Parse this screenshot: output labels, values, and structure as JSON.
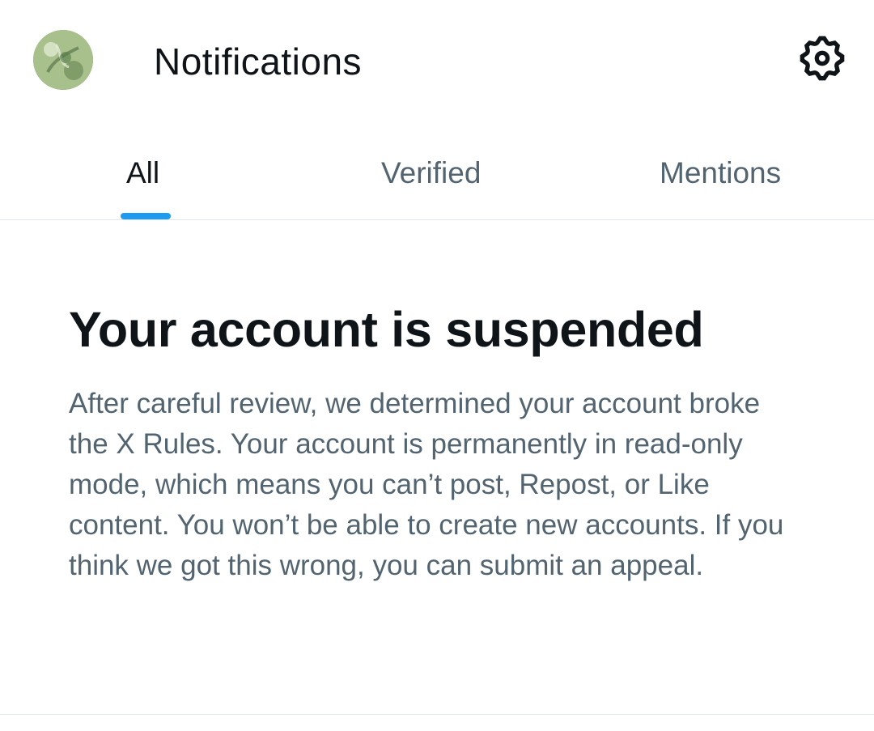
{
  "header": {
    "title": "Notifications",
    "avatar_icon": "profile-avatar",
    "settings_icon": "gear-icon"
  },
  "tabs": [
    {
      "label": "All",
      "active": true
    },
    {
      "label": "Verified",
      "active": false
    },
    {
      "label": "Mentions",
      "active": false
    }
  ],
  "notice": {
    "title": "Your account is suspended",
    "body": "After careful review, we determined your account broke the X Rules. Your account is permanently in read-only mode, which means you can’t post, Repost, or Like content. You won’t be able to create new accounts. If you think we got this wrong, you can submit an appeal."
  },
  "colors": {
    "accent": "#1d9bf0",
    "primary_text": "#0f1419",
    "secondary_text": "#536471",
    "divider": "#e1e6ea"
  }
}
